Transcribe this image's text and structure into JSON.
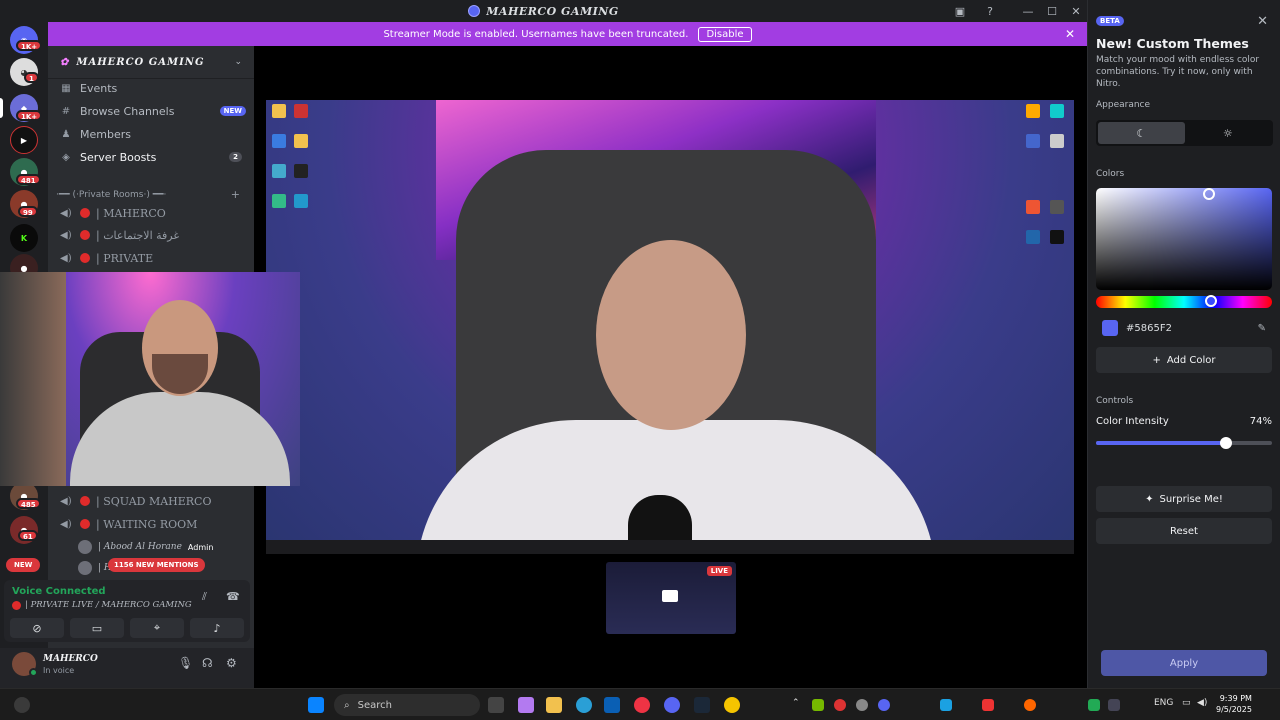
{
  "window": {
    "title": "MAHERCO GAMING"
  },
  "banner": {
    "text": "Streamer Mode is enabled. Usernames have been truncated.",
    "disable_label": "Disable"
  },
  "rail": {
    "badges": [
      "1K+",
      "1",
      "1K+",
      "481",
      "99",
      "485",
      "61"
    ],
    "new_label": "NEW"
  },
  "sidebar": {
    "server_name": "MAHERCO GAMING",
    "items": [
      {
        "label": "Events",
        "icon": "calendar-icon"
      },
      {
        "label": "Browse Channels",
        "icon": "browse-icon",
        "tag": "NEW"
      },
      {
        "label": "Members",
        "icon": "members-icon"
      },
      {
        "label": "Server Boosts",
        "icon": "boost-icon",
        "count": "2"
      }
    ],
    "category": "·━━ (·Private Rooms·) ━━·",
    "channels_top": [
      "| MAHERCO",
      "| غرفة الاجتماعات",
      "| PRIVATE"
    ],
    "channels_bottom": [
      "| SQUAD MAHERCO",
      "| WAITING ROOM"
    ],
    "members": [
      {
        "name": "| Abood Al Horane",
        "tag": "Admin"
      },
      {
        "name": "| H"
      }
    ],
    "mentions": "1156 NEW MENTIONS"
  },
  "voice": {
    "status": "Voice Connected",
    "channel": "| PRIVATE LIVE / MAHERCO GAMING"
  },
  "user": {
    "name": "MAHERCO",
    "status": "In voice"
  },
  "preview": {
    "live": "LIVE"
  },
  "panel": {
    "beta": "BETA",
    "title": "New! Custom Themes",
    "description": "Match your mood with endless color combinations. Try it now, only with Nitro.",
    "appearance_label": "Appearance",
    "colors_label": "Colors",
    "hex": "#5865F2",
    "add_color": "Add Color",
    "controls_label": "Controls",
    "intensity_label": "Color Intensity",
    "intensity_value": "74%",
    "intensity_fraction": 0.74,
    "surprise": "Surprise Me!",
    "reset": "Reset",
    "apply": "Apply",
    "accent": "#5865F2"
  },
  "taskbar": {
    "search_placeholder": "Search",
    "lang": "ENG",
    "time": "9:39 PM",
    "date": "9/5/2025"
  }
}
